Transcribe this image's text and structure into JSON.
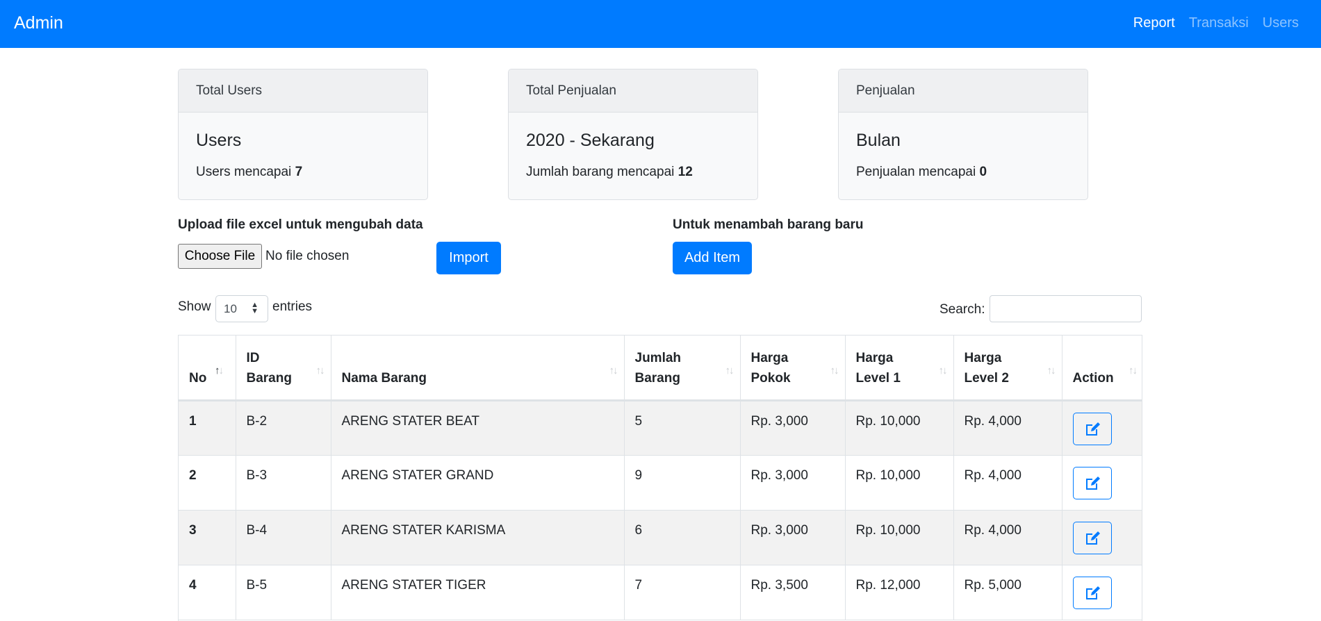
{
  "navbar": {
    "brand": "Admin",
    "links": [
      {
        "label": "Report",
        "active": true
      },
      {
        "label": "Transaksi",
        "active": false
      },
      {
        "label": "Users",
        "active": false
      }
    ]
  },
  "cards": [
    {
      "header": "Total Users",
      "title": "Users",
      "text": "Users mencapai ",
      "value": "7"
    },
    {
      "header": "Total Penjualan",
      "title": "2020 - Sekarang",
      "text": "Jumlah barang mencapai ",
      "value": "12"
    },
    {
      "header": "Penjualan",
      "title": "Bulan",
      "text": "Penjualan mencapai ",
      "value": "0"
    }
  ],
  "upload": {
    "label": "Upload file excel untuk mengubah data",
    "choose_file_label": "Choose File",
    "file_status": "No file chosen",
    "import_label": "Import"
  },
  "add": {
    "label": "Untuk menambah barang baru",
    "button_label": "Add Item"
  },
  "table_controls": {
    "show_label": "Show",
    "entries_value": "10",
    "entries_label": "entries",
    "search_label": "Search:",
    "search_value": ""
  },
  "table": {
    "columns": [
      {
        "line1": "",
        "line2": "No"
      },
      {
        "line1": "ID",
        "line2": "Barang"
      },
      {
        "line1": "",
        "line2": "Nama Barang"
      },
      {
        "line1": "Jumlah",
        "line2": "Barang"
      },
      {
        "line1": "Harga",
        "line2": "Pokok"
      },
      {
        "line1": "Harga",
        "line2": "Level 1"
      },
      {
        "line1": "Harga",
        "line2": "Level 2"
      },
      {
        "line1": "",
        "line2": "Action"
      }
    ],
    "sorted_column": "No",
    "sort_direction": "ascending",
    "rows": [
      {
        "no": "1",
        "id": "B-2",
        "nama": "ARENG STATER BEAT",
        "jumlah": "5",
        "pokok": "Rp. 3,000",
        "level1": "Rp. 10,000",
        "level2": "Rp. 4,000",
        "action_icon": "edit-icon"
      },
      {
        "no": "2",
        "id": "B-3",
        "nama": "ARENG STATER GRAND",
        "jumlah": "9",
        "pokok": "Rp. 3,000",
        "level1": "Rp. 10,000",
        "level2": "Rp. 4,000",
        "action_icon": "edit-icon"
      },
      {
        "no": "3",
        "id": "B-4",
        "nama": "ARENG STATER KARISMA",
        "jumlah": "6",
        "pokok": "Rp. 3,000",
        "level1": "Rp. 10,000",
        "level2": "Rp. 4,000",
        "action_icon": "edit-icon"
      },
      {
        "no": "4",
        "id": "B-5",
        "nama": "ARENG STATER TIGER",
        "jumlah": "7",
        "pokok": "Rp. 3,500",
        "level1": "Rp. 12,000",
        "level2": "Rp. 5,000",
        "action_icon": "edit-icon"
      }
    ]
  },
  "colors": {
    "primary": "#007bff",
    "navbar_text_inactive": "rgba(255,255,255,0.55)",
    "stripe": "#f2f2f2"
  }
}
